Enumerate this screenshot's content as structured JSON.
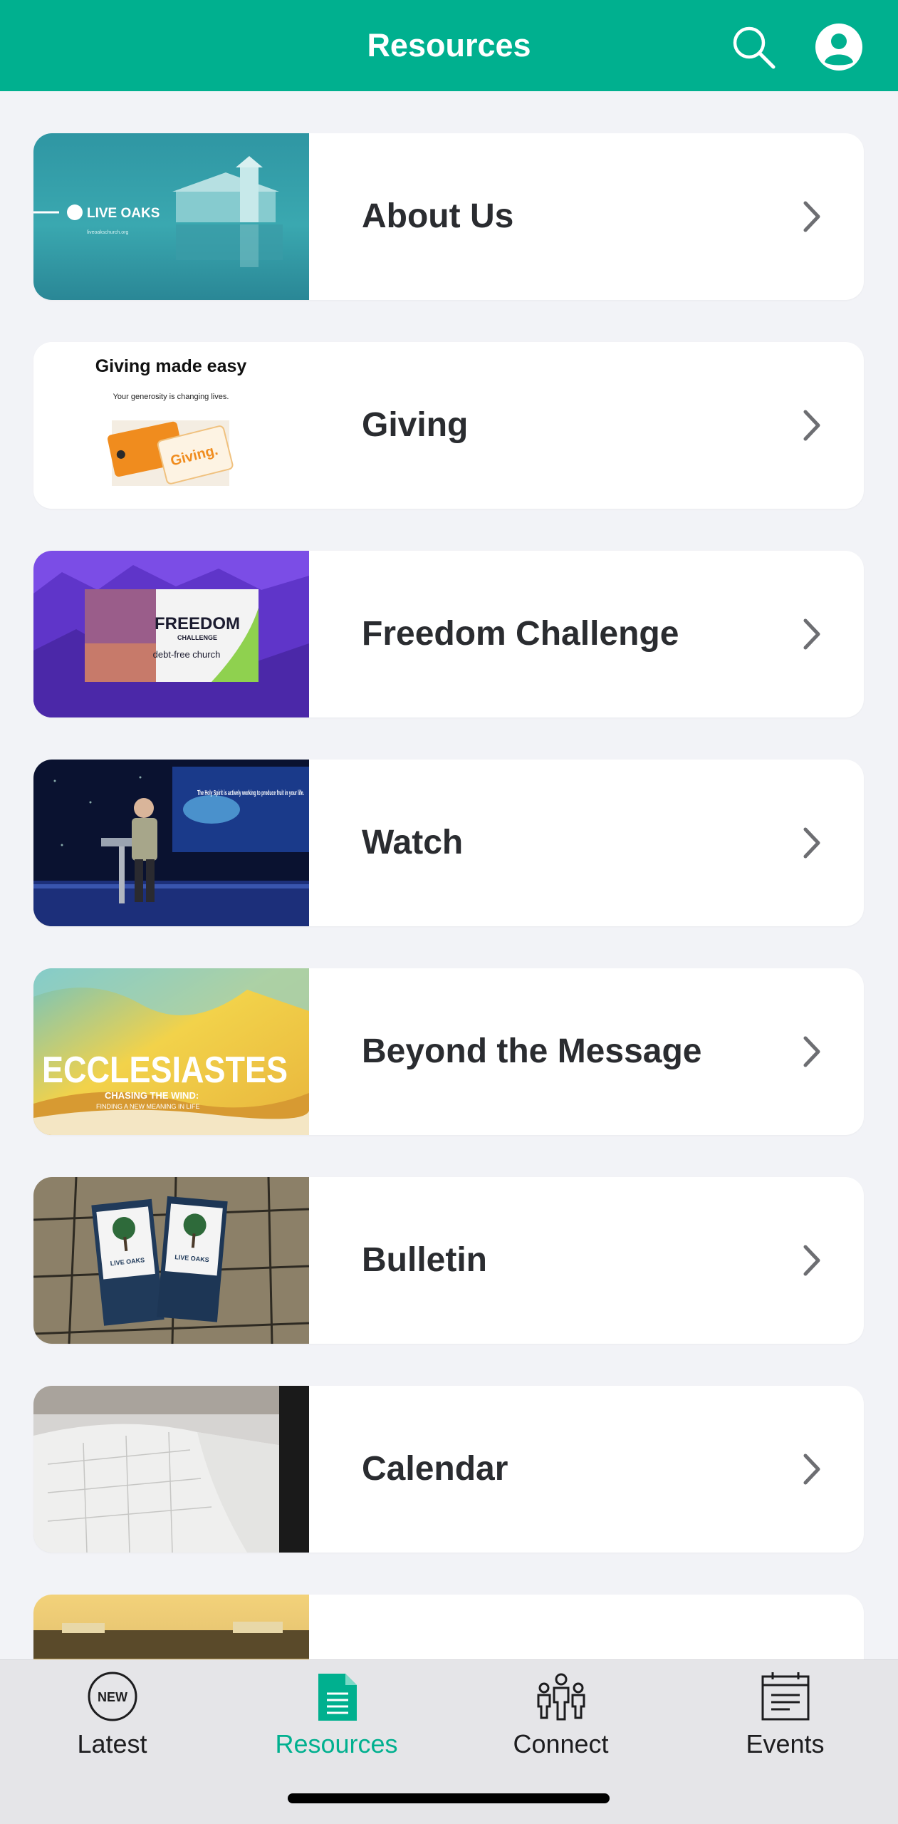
{
  "header": {
    "title": "Resources",
    "search_icon": "search-icon",
    "profile_icon": "user-avatar-icon",
    "background_color": "#00b08f"
  },
  "cards": [
    {
      "label": "About Us",
      "thumbnail": "church-building-reflection",
      "thumb_text": "LIVE OAKS",
      "thumb_subtext": "liveoakschurch.org"
    },
    {
      "label": "Giving",
      "thumbnail": "giving-cards",
      "thumb_text": "Giving made easy",
      "thumb_subtext": "Your generosity is changing lives.",
      "thumb_card_text": "Giving."
    },
    {
      "label": "Freedom Challenge",
      "thumbnail": "freedom-challenge-banner",
      "thumb_text": "FREEDOM",
      "thumb_subtext": "CHALLENGE",
      "thumb_detail": "debt-free church"
    },
    {
      "label": "Watch",
      "thumbnail": "pastor-on-stage",
      "thumb_text": "The Holy Spirit is actively working to produce fruit in your life."
    },
    {
      "label": "Beyond the Message",
      "thumbnail": "ecclesiastes-series-art",
      "thumb_text": "ECCLESIASTES",
      "thumb_subtext": "CHASING THE WIND:",
      "thumb_detail": "FINDING A NEW MEANING IN LIFE"
    },
    {
      "label": "Bulletin",
      "thumbnail": "printed-bulletins-on-pavers",
      "thumb_text": "LIVE OAKS"
    },
    {
      "label": "Calendar",
      "thumbnail": "open-planner-book"
    },
    {
      "label": "",
      "thumbnail": "campus-sunset-partial"
    }
  ],
  "chevron_icon": "chevron-right-icon",
  "tabs": [
    {
      "label": "Latest",
      "icon": "new-badge-icon",
      "icon_text": "NEW",
      "active": false
    },
    {
      "label": "Resources",
      "icon": "document-icon",
      "active": true
    },
    {
      "label": "Connect",
      "icon": "people-group-icon",
      "active": false
    },
    {
      "label": "Events",
      "icon": "calendar-board-icon",
      "active": false
    }
  ],
  "colors": {
    "accent": "#00b08f",
    "background": "#f2f3f7",
    "card": "#ffffff",
    "label_text": "#2a2c30",
    "chevron": "#6d6e72",
    "tabbar": "#e5e5e8"
  }
}
